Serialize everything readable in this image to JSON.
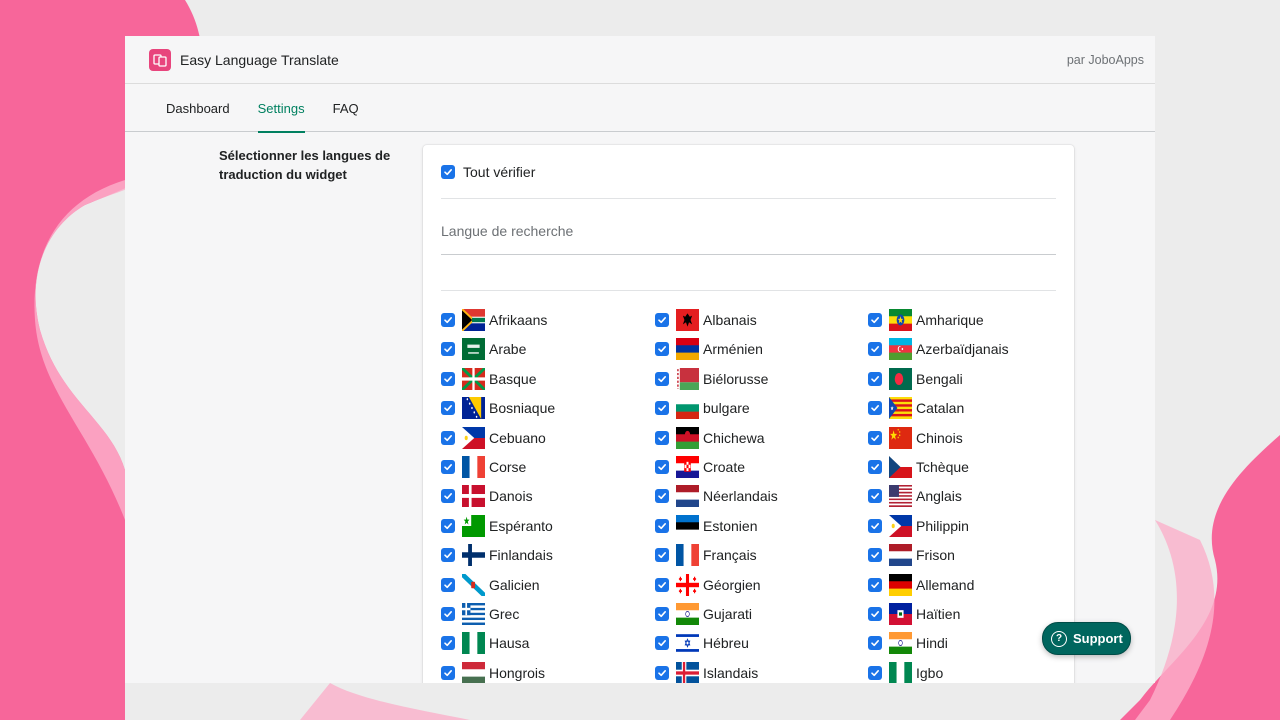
{
  "app": {
    "title": "Easy Language Translate",
    "byline": "par JoboApps",
    "accent": "#e8457d"
  },
  "nav": {
    "tabs": [
      {
        "label": "Dashboard",
        "active": false
      },
      {
        "label": "Settings",
        "active": true
      },
      {
        "label": "FAQ",
        "active": false
      }
    ],
    "active_color": "#008060"
  },
  "settings": {
    "section_label": "Sélectionner les langues de traduction du widget",
    "check_all_label": "Tout vérifier",
    "check_all_checked": true,
    "search_placeholder": "Langue de recherche",
    "search_value": ""
  },
  "languages": [
    {
      "name": "Afrikaans",
      "flag": "za",
      "checked": true
    },
    {
      "name": "Albanais",
      "flag": "al",
      "checked": true
    },
    {
      "name": "Amharique",
      "flag": "et",
      "checked": true
    },
    {
      "name": "Arabe",
      "flag": "sa",
      "checked": true
    },
    {
      "name": "Arménien",
      "flag": "am",
      "checked": true
    },
    {
      "name": "Azerbaïdjanais",
      "flag": "az",
      "checked": true
    },
    {
      "name": "Basque",
      "flag": "eus",
      "checked": true
    },
    {
      "name": "Biélorusse",
      "flag": "by",
      "checked": true
    },
    {
      "name": "Bengali",
      "flag": "bd",
      "checked": true
    },
    {
      "name": "Bosniaque",
      "flag": "ba",
      "checked": true
    },
    {
      "name": "bulgare",
      "flag": "bg",
      "checked": true
    },
    {
      "name": "Catalan",
      "flag": "cat",
      "checked": true
    },
    {
      "name": "Cebuano",
      "flag": "ph",
      "checked": true
    },
    {
      "name": "Chichewa",
      "flag": "mw",
      "checked": true
    },
    {
      "name": "Chinois",
      "flag": "cn",
      "checked": true
    },
    {
      "name": "Corse",
      "flag": "fr",
      "checked": true
    },
    {
      "name": "Croate",
      "flag": "hr",
      "checked": true
    },
    {
      "name": "Tchèque",
      "flag": "cz",
      "checked": true
    },
    {
      "name": "Danois",
      "flag": "dk",
      "checked": true
    },
    {
      "name": "Néerlandais",
      "flag": "nl",
      "checked": true
    },
    {
      "name": "Anglais",
      "flag": "us",
      "checked": true
    },
    {
      "name": "Espéranto",
      "flag": "eo",
      "checked": true
    },
    {
      "name": "Estonien",
      "flag": "ee",
      "checked": true
    },
    {
      "name": "Philippin",
      "flag": "ph",
      "checked": true
    },
    {
      "name": "Finlandais",
      "flag": "fi",
      "checked": true
    },
    {
      "name": "Français",
      "flag": "fr",
      "checked": true
    },
    {
      "name": "Frison",
      "flag": "nl",
      "checked": true
    },
    {
      "name": "Galicien",
      "flag": "gal",
      "checked": true
    },
    {
      "name": "Géorgien",
      "flag": "ge",
      "checked": true
    },
    {
      "name": "Allemand",
      "flag": "de",
      "checked": true
    },
    {
      "name": "Grec",
      "flag": "gr",
      "checked": true
    },
    {
      "name": "Gujarati",
      "flag": "in",
      "checked": true
    },
    {
      "name": "Haïtien",
      "flag": "ht",
      "checked": true
    },
    {
      "name": "Hausa",
      "flag": "ng",
      "checked": true
    },
    {
      "name": "Hébreu",
      "flag": "il",
      "checked": true
    },
    {
      "name": "Hindi",
      "flag": "in",
      "checked": true
    },
    {
      "name": "Hongrois",
      "flag": "hu",
      "checked": true
    },
    {
      "name": "Islandais",
      "flag": "is",
      "checked": true
    },
    {
      "name": "Igbo",
      "flag": "ng",
      "checked": true
    }
  ],
  "support": {
    "label": "Support",
    "color": "#00665e"
  }
}
